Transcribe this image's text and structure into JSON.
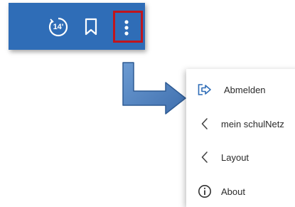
{
  "toolbar": {
    "timer_value": "14'",
    "accent_color": "#2f6db7",
    "highlight_color": "#c0151d",
    "icons": [
      "timer-icon",
      "bookmark-icon",
      "more-vertical-icon"
    ]
  },
  "arrow": {
    "color": "#4f81bd",
    "icon": "arrow-icon"
  },
  "menu": {
    "items": [
      {
        "label": "Abmelden",
        "icon": "logout-icon"
      },
      {
        "label": "mein schulNetz",
        "icon": "chevron-left-icon"
      },
      {
        "label": "Layout",
        "icon": "chevron-left-icon"
      },
      {
        "label": "About",
        "icon": "info-icon"
      }
    ]
  }
}
